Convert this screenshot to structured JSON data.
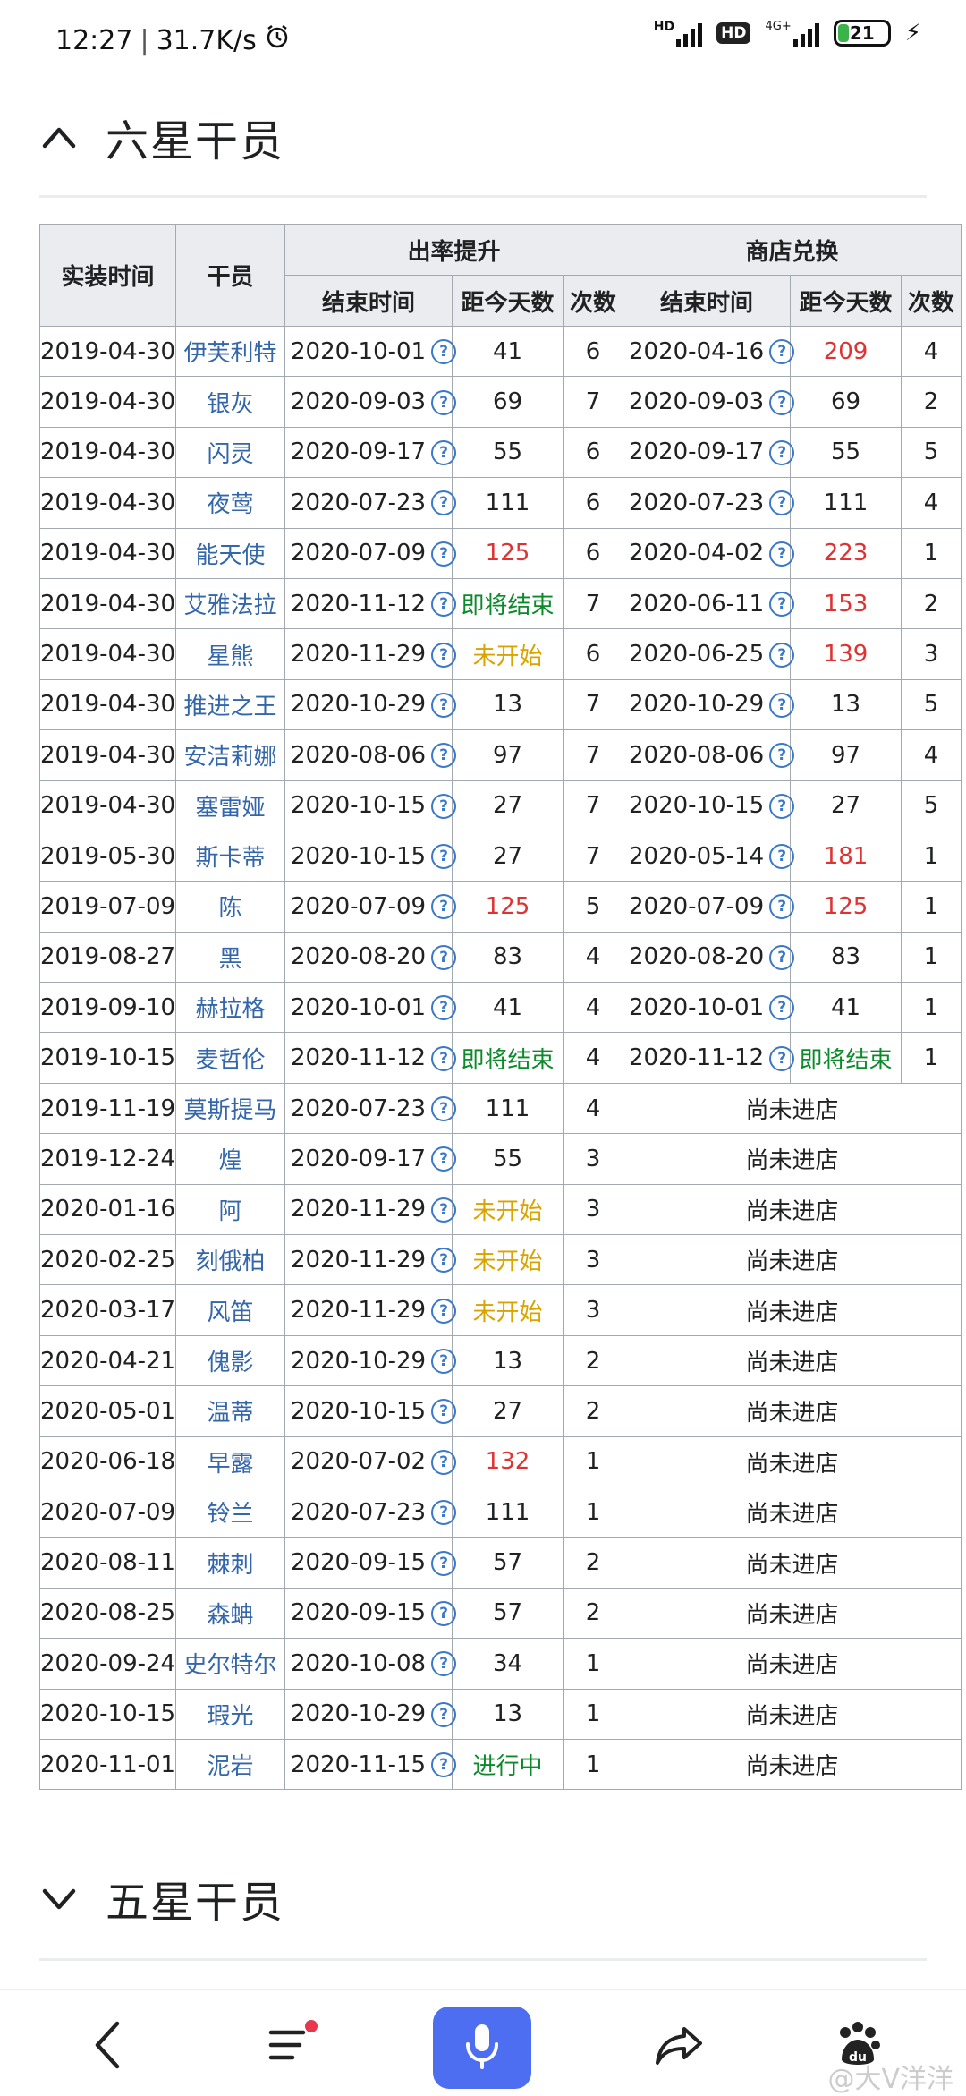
{
  "status_bar": {
    "time": "12:27",
    "speed": "31.7K/s",
    "network_hd": "HD",
    "network_hd2": "HD",
    "network_4g": "4G+",
    "battery": "21"
  },
  "section1": {
    "title": "六星干员"
  },
  "section2": {
    "title": "五星干员"
  },
  "table": {
    "headers": {
      "release": "实装时间",
      "operator": "干员",
      "rateup": "出率提升",
      "shop": "商店兑换",
      "end": "结束时间",
      "days": "距今天数",
      "count": "次数",
      "shop_end": "结束时间",
      "shop_days": "距今天数",
      "shop_count": "次数"
    },
    "rows": [
      {
        "release": "2019-04-30",
        "name": "伊芙利特",
        "r_end": "2020-10-01",
        "r_days": "41",
        "r_days_color": "",
        "r_count": "6",
        "s_end": "2020-04-16",
        "s_days": "209",
        "s_days_color": "red",
        "s_count": "4"
      },
      {
        "release": "2019-04-30",
        "name": "银灰",
        "r_end": "2020-09-03",
        "r_days": "69",
        "r_days_color": "",
        "r_count": "7",
        "s_end": "2020-09-03",
        "s_days": "69",
        "s_days_color": "",
        "s_count": "2"
      },
      {
        "release": "2019-04-30",
        "name": "闪灵",
        "r_end": "2020-09-17",
        "r_days": "55",
        "r_days_color": "",
        "r_count": "6",
        "s_end": "2020-09-17",
        "s_days": "55",
        "s_days_color": "",
        "s_count": "5"
      },
      {
        "release": "2019-04-30",
        "name": "夜莺",
        "r_end": "2020-07-23",
        "r_days": "111",
        "r_days_color": "",
        "r_count": "6",
        "s_end": "2020-07-23",
        "s_days": "111",
        "s_days_color": "",
        "s_count": "4"
      },
      {
        "release": "2019-04-30",
        "name": "能天使",
        "r_end": "2020-07-09",
        "r_days": "125",
        "r_days_color": "red",
        "r_count": "6",
        "s_end": "2020-04-02",
        "s_days": "223",
        "s_days_color": "red",
        "s_count": "1"
      },
      {
        "release": "2019-04-30",
        "name": "艾雅法拉",
        "r_end": "2020-11-12",
        "r_days": "即将结束",
        "r_days_color": "green",
        "r_count": "7",
        "s_end": "2020-06-11",
        "s_days": "153",
        "s_days_color": "red",
        "s_count": "2"
      },
      {
        "release": "2019-04-30",
        "name": "星熊",
        "r_end": "2020-11-29",
        "r_days": "未开始",
        "r_days_color": "amber",
        "r_count": "6",
        "s_end": "2020-06-25",
        "s_days": "139",
        "s_days_color": "red",
        "s_count": "3"
      },
      {
        "release": "2019-04-30",
        "name": "推进之王",
        "r_end": "2020-10-29",
        "r_days": "13",
        "r_days_color": "",
        "r_count": "7",
        "s_end": "2020-10-29",
        "s_days": "13",
        "s_days_color": "",
        "s_count": "5"
      },
      {
        "release": "2019-04-30",
        "name": "安洁莉娜",
        "r_end": "2020-08-06",
        "r_days": "97",
        "r_days_color": "",
        "r_count": "7",
        "s_end": "2020-08-06",
        "s_days": "97",
        "s_days_color": "",
        "s_count": "4"
      },
      {
        "release": "2019-04-30",
        "name": "塞雷娅",
        "r_end": "2020-10-15",
        "r_days": "27",
        "r_days_color": "",
        "r_count": "7",
        "s_end": "2020-10-15",
        "s_days": "27",
        "s_days_color": "",
        "s_count": "5"
      },
      {
        "release": "2019-05-30",
        "name": "斯卡蒂",
        "r_end": "2020-10-15",
        "r_days": "27",
        "r_days_color": "",
        "r_count": "7",
        "s_end": "2020-05-14",
        "s_days": "181",
        "s_days_color": "red",
        "s_count": "1"
      },
      {
        "release": "2019-07-09",
        "name": "陈",
        "r_end": "2020-07-09",
        "r_days": "125",
        "r_days_color": "red",
        "r_count": "5",
        "s_end": "2020-07-09",
        "s_days": "125",
        "s_days_color": "red",
        "s_count": "1"
      },
      {
        "release": "2019-08-27",
        "name": "黑",
        "r_end": "2020-08-20",
        "r_days": "83",
        "r_days_color": "",
        "r_count": "4",
        "s_end": "2020-08-20",
        "s_days": "83",
        "s_days_color": "",
        "s_count": "1"
      },
      {
        "release": "2019-09-10",
        "name": "赫拉格",
        "r_end": "2020-10-01",
        "r_days": "41",
        "r_days_color": "",
        "r_count": "4",
        "s_end": "2020-10-01",
        "s_days": "41",
        "s_days_color": "",
        "s_count": "1"
      },
      {
        "release": "2019-10-15",
        "name": "麦哲伦",
        "r_end": "2020-11-12",
        "r_days": "即将结束",
        "r_days_color": "green",
        "r_count": "4",
        "s_end": "2020-11-12",
        "s_days": "即将结束",
        "s_days_color": "green",
        "s_count": "1"
      },
      {
        "release": "2019-11-19",
        "name": "莫斯提马",
        "r_end": "2020-07-23",
        "r_days": "111",
        "r_days_color": "",
        "r_count": "4",
        "shop_note": "尚未进店"
      },
      {
        "release": "2019-12-24",
        "name": "煌",
        "r_end": "2020-09-17",
        "r_days": "55",
        "r_days_color": "",
        "r_count": "3",
        "shop_note": "尚未进店"
      },
      {
        "release": "2020-01-16",
        "name": "阿",
        "r_end": "2020-11-29",
        "r_days": "未开始",
        "r_days_color": "amber",
        "r_count": "3",
        "shop_note": "尚未进店"
      },
      {
        "release": "2020-02-25",
        "name": "刻俄柏",
        "r_end": "2020-11-29",
        "r_days": "未开始",
        "r_days_color": "amber",
        "r_count": "3",
        "shop_note": "尚未进店"
      },
      {
        "release": "2020-03-17",
        "name": "风笛",
        "r_end": "2020-11-29",
        "r_days": "未开始",
        "r_days_color": "amber",
        "r_count": "3",
        "shop_note": "尚未进店"
      },
      {
        "release": "2020-04-21",
        "name": "傀影",
        "r_end": "2020-10-29",
        "r_days": "13",
        "r_days_color": "",
        "r_count": "2",
        "shop_note": "尚未进店"
      },
      {
        "release": "2020-05-01",
        "name": "温蒂",
        "r_end": "2020-10-15",
        "r_days": "27",
        "r_days_color": "",
        "r_count": "2",
        "shop_note": "尚未进店"
      },
      {
        "release": "2020-06-18",
        "name": "早露",
        "r_end": "2020-07-02",
        "r_days": "132",
        "r_days_color": "red",
        "r_count": "1",
        "shop_note": "尚未进店"
      },
      {
        "release": "2020-07-09",
        "name": "铃兰",
        "r_end": "2020-07-23",
        "r_days": "111",
        "r_days_color": "",
        "r_count": "1",
        "shop_note": "尚未进店"
      },
      {
        "release": "2020-08-11",
        "name": "棘刺",
        "r_end": "2020-09-15",
        "r_days": "57",
        "r_days_color": "",
        "r_count": "2",
        "shop_note": "尚未进店"
      },
      {
        "release": "2020-08-25",
        "name": "森蚺",
        "r_end": "2020-09-15",
        "r_days": "57",
        "r_days_color": "",
        "r_count": "2",
        "shop_note": "尚未进店"
      },
      {
        "release": "2020-09-24",
        "name": "史尔特尔",
        "r_end": "2020-10-08",
        "r_days": "34",
        "r_days_color": "",
        "r_count": "1",
        "shop_note": "尚未进店"
      },
      {
        "release": "2020-10-15",
        "name": "瑕光",
        "r_end": "2020-10-29",
        "r_days": "13",
        "r_days_color": "",
        "r_count": "1",
        "shop_note": "尚未进店"
      },
      {
        "release": "2020-11-01",
        "name": "泥岩",
        "r_end": "2020-11-15",
        "r_days": "进行中",
        "r_days_color": "green",
        "r_count": "1",
        "shop_note": "尚未进店"
      }
    ]
  },
  "help_glyph": "?",
  "bottom_nav": {
    "icons": [
      "back-icon",
      "menu-icon",
      "microphone-icon",
      "share-icon",
      "baidu-paw-icon"
    ]
  },
  "watermark": "@大V洋洋",
  "colors": {
    "link": "#3366aa",
    "red": "#dd3333",
    "amber": "#d9a400",
    "green": "#0b8a2a",
    "header_bg": "#eaecf0",
    "mic_bg": "#4e6ef2"
  }
}
